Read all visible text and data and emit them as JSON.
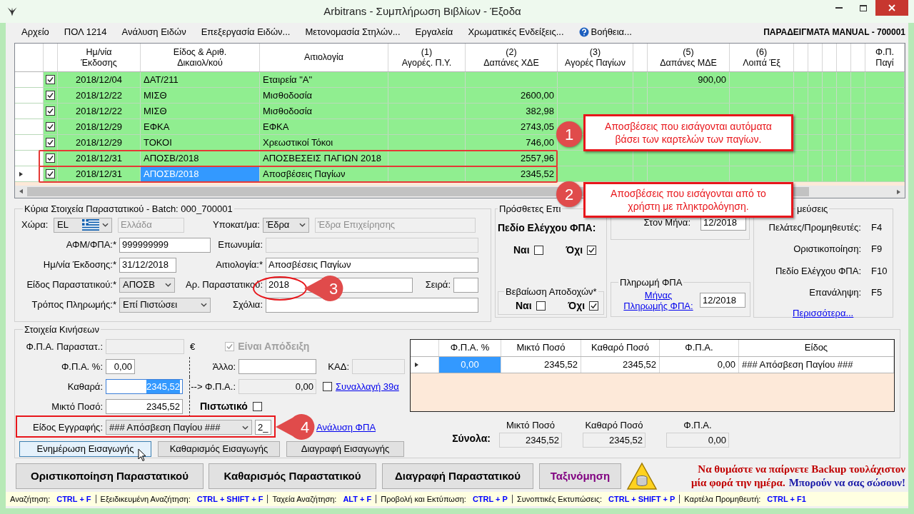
{
  "window": {
    "title": "Arbitrans - Συμπλήρωση Βιβλίων - Έξοδα"
  },
  "menu": [
    {
      "label": "Αρχείο",
      "kind": "plain"
    },
    {
      "label": "ΠΟΛ 1214",
      "kind": "plain"
    },
    {
      "label": "Ανάλυση Ειδών",
      "kind": "plain"
    },
    {
      "label": "Επεξεργασία Ειδών...",
      "kind": "plain"
    },
    {
      "label": "Μετονομασία Στηλών...",
      "kind": "plain"
    },
    {
      "label": "Εργαλεία",
      "kind": "plain"
    },
    {
      "label": "Χρωματικές Ενδείξεις...",
      "kind": "plain"
    },
    {
      "label": "Βοήθεια...",
      "kind": "help"
    }
  ],
  "company": "ΠΑΡΑΔΕΙΓΜΑΤΑ MANUAL - 700001",
  "grid": {
    "columns": [
      {
        "lines": [
          "Ημ/νία",
          "Έκδοσης"
        ]
      },
      {
        "lines": [
          "Είδος & Αριθ.",
          "Δικαιολ/κού"
        ]
      },
      {
        "lines": [
          "Αιτιολογία"
        ]
      },
      {
        "lines": [
          "(1)",
          "Αγορές. Π.Υ."
        ]
      },
      {
        "lines": [
          "(2)",
          "Δαπάνες ΧΔΕ"
        ]
      },
      {
        "lines": [
          "(3)",
          "Αγορές Παγίων"
        ]
      },
      {},
      {
        "lines": [
          "(5)",
          "Δαπάνες ΜΔΕ"
        ]
      },
      {
        "lines": [
          "(6)",
          "Λοιπά Έξ"
        ]
      },
      {},
      {},
      {},
      {},
      {},
      {
        "lines": [
          "Φ.Π.",
          "Παγί"
        ]
      }
    ],
    "rows": [
      {
        "checked": true,
        "current": false,
        "highlighted": false,
        "cells": [
          "2018/12/04",
          "ΔΑΤ/211",
          "Εταιρεία \"Α\"",
          null,
          null,
          null,
          null,
          "900,00",
          null,
          null,
          null,
          null,
          null,
          null,
          null
        ]
      },
      {
        "checked": true,
        "current": false,
        "highlighted": false,
        "cells": [
          "2018/12/22",
          "ΜΙΣΘ",
          "Μισθοδοσία",
          null,
          "2600,00",
          null,
          null,
          null,
          null,
          null,
          null,
          null,
          null,
          null,
          null
        ]
      },
      {
        "checked": true,
        "current": false,
        "highlighted": false,
        "cells": [
          "2018/12/22",
          "ΜΙΣΘ",
          "Μισθοδοσία",
          null,
          "382,98",
          null,
          null,
          null,
          null,
          null,
          null,
          null,
          null,
          null,
          null
        ]
      },
      {
        "checked": true,
        "current": false,
        "highlighted": false,
        "cells": [
          "2018/12/29",
          "ΕΦΚΑ",
          "ΕΦΚΑ",
          null,
          "2743,05",
          null,
          null,
          null,
          null,
          null,
          null,
          null,
          null,
          null,
          null
        ]
      },
      {
        "checked": true,
        "current": false,
        "highlighted": false,
        "cells": [
          "2018/12/29",
          "ΤΟΚΟΙ",
          "Χρεωστικοί Τόκοι",
          null,
          "746,00",
          null,
          null,
          null,
          null,
          null,
          null,
          null,
          null,
          null,
          null
        ]
      },
      {
        "checked": true,
        "current": false,
        "highlighted": true,
        "cells": [
          "2018/12/31",
          "ΑΠΟΣΒ/2018",
          "ΑΠΟΣΒΕΣΕΙΣ ΠΑΓΙΩΝ 2018",
          null,
          "2557,96",
          null,
          null,
          null,
          null,
          null,
          null,
          null,
          null,
          null,
          null
        ]
      },
      {
        "checked": true,
        "current": true,
        "highlighted": true,
        "cells": [
          "2018/12/31",
          "ΑΠΟΣΒ/2018",
          "Αποσβέσεις Παγίων",
          null,
          "2345,52",
          null,
          null,
          null,
          null,
          null,
          null,
          null,
          null,
          null,
          null
        ]
      }
    ]
  },
  "annotations": [
    {
      "number": "1",
      "kind": "note",
      "text": "Αποσβέσεις που εισάγονται αυτόματα βάσει των καρτελών των παγίων."
    },
    {
      "number": "2",
      "kind": "note",
      "text": "Αποσβέσεις που εισάγονται από το χρήστη με πληκτρολόγηση."
    },
    {
      "number": "3",
      "kind": "ellipse_marker"
    },
    {
      "number": "4",
      "kind": "frame_marker"
    }
  ],
  "main_document": {
    "title": "Κύρια Στοιχεία Παραστατικού - Batch: 000_700001",
    "country": {
      "label": "Χώρα:",
      "value": "EL"
    },
    "country_name": {
      "value": "Ελλάδα",
      "disabled": true
    },
    "branch": {
      "label": "Υποκατ/μα:",
      "value": "Έδρα"
    },
    "branch_name": {
      "value": "Έδρα Επιχείρησης",
      "disabled": true
    },
    "vat_id": {
      "label": "ΑΦΜ/ΦΠΑ:*",
      "value": "999999999"
    },
    "company_name": {
      "label": "Επωνυμία:",
      "disabled": true
    },
    "issue_date": {
      "label": "Ημ/νία Έκδοσης:*",
      "value": "31/12/2018"
    },
    "reason": {
      "label": "Αιτιολογία:*",
      "value": "Αποσβέσεις Παγίων"
    },
    "doc_type": {
      "label": "Είδος Παραστατικού:*",
      "value": "ΑΠΟΣΒ"
    },
    "doc_number": {
      "label": "Αρ. Παραστατικού:",
      "value": "2018"
    },
    "series": {
      "label": "Σειρά:"
    },
    "payment": {
      "label": "Τρόπος Πληρωμής:*",
      "value": "Επί Πιστώσει"
    },
    "comments": {
      "label": "Σχόλια:"
    }
  },
  "extra": {
    "title": "Πρόσθετες Επι",
    "vat_check": {
      "label": "Πεδίο Ελέγχου ΦΠΑ:",
      "yes": {
        "label": "Ναι",
        "checked": false
      },
      "no": {
        "label": "Όχι",
        "checked": true
      }
    },
    "income_cert": {
      "title": "Βεβαίωση Αποδοχών*",
      "yes": {
        "label": "Ναι",
        "checked": false
      },
      "no": {
        "label": "Όχι",
        "checked": true
      }
    }
  },
  "month": {
    "label": "Στον Μήνα:",
    "value": "12/2018"
  },
  "vat_payment": {
    "title": "Πληρωμή ΦΠΑ",
    "link": "Μήνας Πληρωμής ΦΠΑ:",
    "value": "12/2018"
  },
  "shortcuts": {
    "title": "μεύσεις",
    "items": [
      {
        "label": "Πελάτες/Προμηθευτές:",
        "key": "F4"
      },
      {
        "label": "Οριστικοποίηση:",
        "key": "F9"
      },
      {
        "label": "Πεδίο Ελέγχου ΦΠΑ:",
        "key": "F10"
      },
      {
        "label": "Επανάληψη:",
        "key": "F5"
      }
    ],
    "more": "Περισσότερα..."
  },
  "movements": {
    "title": "Στοιχεία Κινήσεων",
    "vat_doc": {
      "label": "Φ.Π.Α. Παραστατ.:",
      "disabled": true,
      "currency": "€"
    },
    "is_receipt": {
      "label": "Είναι Απόδειξη",
      "checked": true,
      "disabled": true
    },
    "vat_pct": {
      "label": "Φ.Π.Α. %:",
      "value": "0,00"
    },
    "other": {
      "label": "Άλλο:"
    },
    "kad": {
      "label": "ΚΑΔ:",
      "disabled": true
    },
    "net": {
      "label": "Καθαρά:",
      "value": "2345,52",
      "focused": true
    },
    "vat_result": {
      "label": "--> Φ.Π.Α.:",
      "value": "0,00",
      "read_only": true
    },
    "transaction_39a": {
      "label": "Συναλλαγή 39α",
      "checked": false
    },
    "gross": {
      "label": "Μικτό Ποσό:",
      "value": "2345,52"
    },
    "credit": {
      "label": "Πιστωτικό",
      "checked": false
    },
    "entry_type": {
      "label": "Είδος Εγγραφής:",
      "value": "### Απόσβεση Παγίου ###",
      "code": "2_"
    },
    "vat_analysis": {
      "label": "Ανάλυση ΦΠΑ"
    },
    "buttons": [
      {
        "label": "Ενημέρωση Εισαγωγής",
        "hovered": true
      },
      {
        "label": "Καθαρισμός Εισαγωγής",
        "hovered": false
      },
      {
        "label": "Διαγραφή Εισαγωγής",
        "hovered": false
      }
    ]
  },
  "vat_grid": {
    "columns": [
      "Φ.Π.Α. %",
      "Μικτό Ποσό",
      "Καθαρό Ποσό",
      "Φ.Π.Α.",
      "Είδος"
    ],
    "rows": [
      {
        "current": true,
        "cells": [
          "0,00",
          "2345,52",
          "2345,52",
          "0,00",
          "### Απόσβεση Παγίου ###"
        ]
      }
    ]
  },
  "totals": {
    "label": "Σύνολα:",
    "items": [
      {
        "label": "Μικτό Ποσό",
        "value": "2345,52"
      },
      {
        "label": "Καθαρό Ποσό",
        "value": "2345,52"
      },
      {
        "label": "Φ.Π.Α.",
        "value": "0,00"
      }
    ]
  },
  "actions": [
    {
      "label": "Οριστικοποίηση Παραστατικού",
      "kind": "plain"
    },
    {
      "label": "Καθαρισμός Παραστατικού",
      "kind": "plain"
    },
    {
      "label": "Διαγραφή Παραστατικού",
      "kind": "plain"
    },
    {
      "label": "Ταξινόμηση",
      "kind": "accent"
    }
  ],
  "backup_notice": {
    "reminder": [
      "Να θυμάστε να παίρνετε Backup τουλάχιστον",
      "μία φορά την ημέρα."
    ],
    "tip": "Μπορούν να σας σώσουν!"
  },
  "status_bar": [
    {
      "label": "Αναζήτηση:",
      "keys": "CTRL + F"
    },
    {
      "label": "Εξειδικευμένη Αναζήτηση:",
      "keys": "CTRL + SHIFT + F"
    },
    {
      "label": "Ταχεία Αναζήτηση:",
      "keys": "ALT + F"
    },
    {
      "label": "Προβολή και Εκτύπωση:",
      "keys": "CTRL + P"
    },
    {
      "label": "Συνοπτικές Εκτυπώσεις:",
      "keys": "CTRL + SHIFT + P"
    },
    {
      "label": "Καρτέλα Προμηθευτή:",
      "keys": "CTRL + F1"
    }
  ]
}
